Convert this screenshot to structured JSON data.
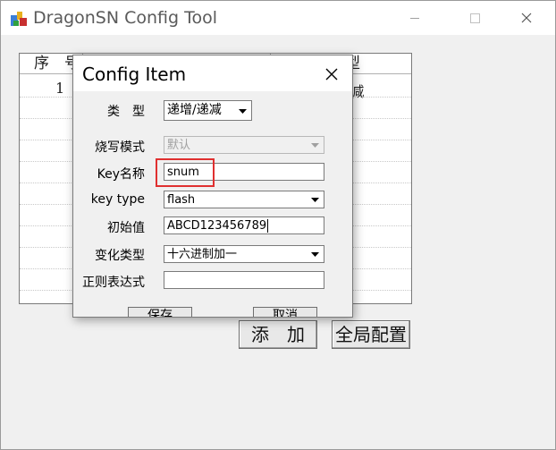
{
  "window": {
    "title": "DragonSN Config Tool",
    "minimize_label": "minimize",
    "maximize_label": "maximize",
    "close_label": "close"
  },
  "table": {
    "columns": [
      "序　号",
      "类　型"
    ],
    "rows": [
      {
        "index": "1",
        "type": "递增/递减"
      }
    ]
  },
  "main_buttons": {
    "add": "添　加",
    "global_config": "全局配置"
  },
  "dialog": {
    "title": "Config Item",
    "fields": {
      "type_label": "类　型",
      "type_value": "递增/递减",
      "burn_mode_label": "烧写模式",
      "burn_mode_value": "默认",
      "key_name_label": "Key名称",
      "key_name_value": "snum",
      "key_type_label": "key type",
      "key_type_value": "flash",
      "init_value_label": "初始值",
      "init_value_value": "ABCD123456789",
      "change_type_label": "变化类型",
      "change_type_value": "十六进制加一",
      "regex_label": "正则表达式",
      "regex_value": ""
    },
    "buttons": {
      "save": "保存",
      "cancel": "取消"
    }
  },
  "colors": {
    "highlight": "#e03030",
    "window_bg": "#f0f0f0"
  }
}
